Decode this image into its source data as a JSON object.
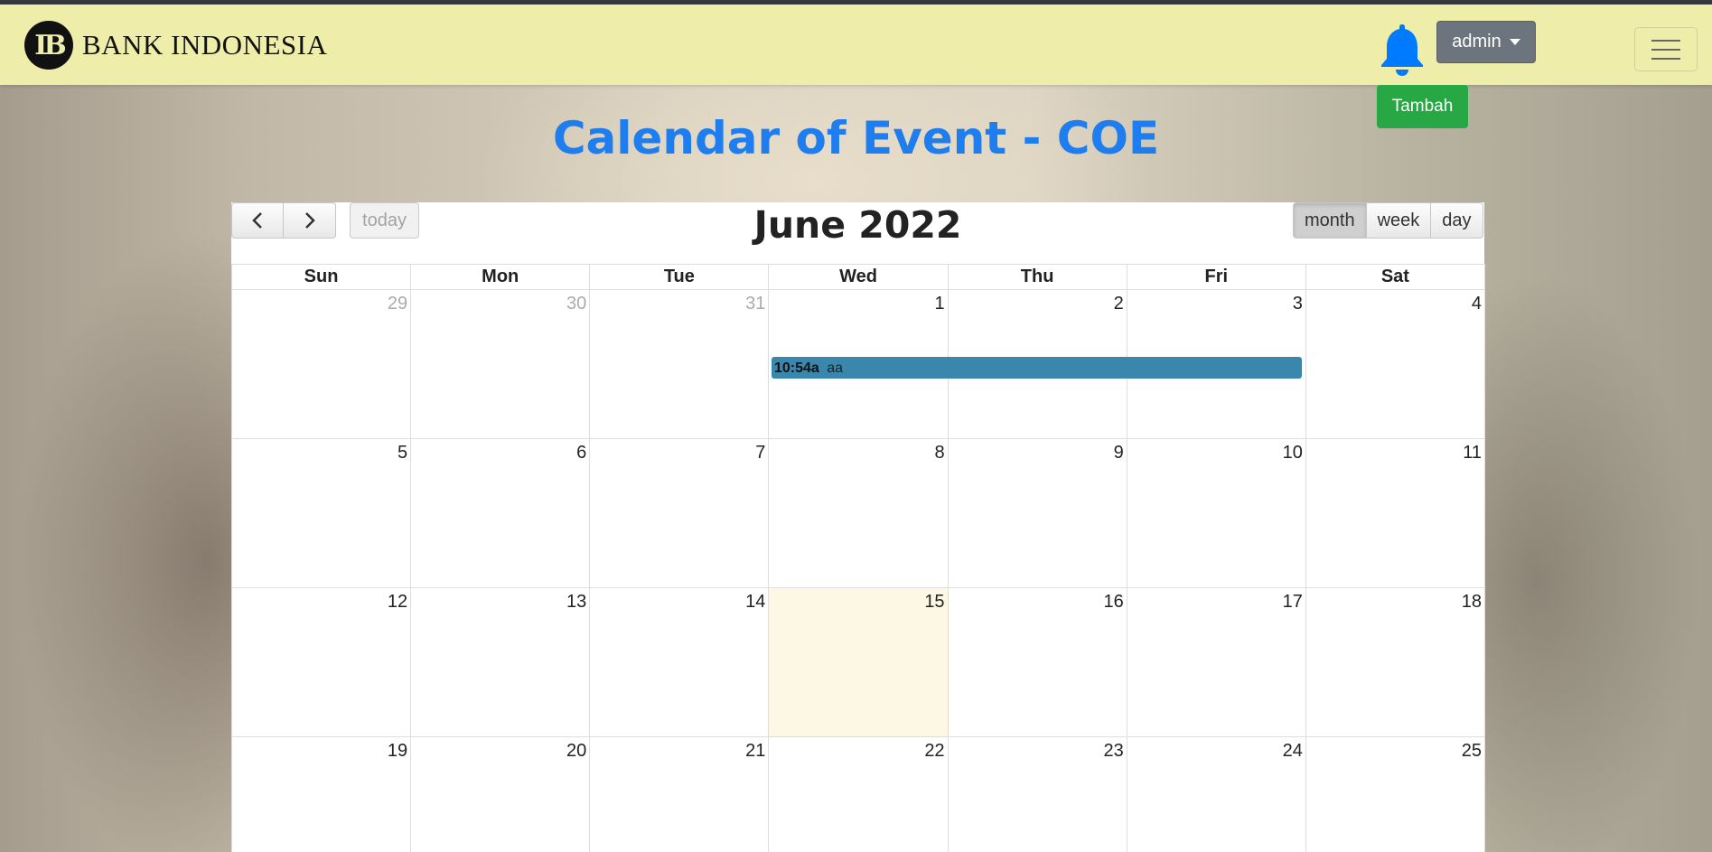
{
  "navbar": {
    "brand_text": "BANK INDONESIA",
    "logo_mark": "IB",
    "bell_icon": "bell-icon",
    "user_button": "admin",
    "menu_icon": "hamburger-menu-icon",
    "bg_color": "#eeeeaa",
    "bell_color": "#007bff"
  },
  "add_button": "Tambah",
  "page_title": "Calendar of Event - COE",
  "calendar": {
    "title": "June 2022",
    "today_button": "today",
    "prev_icon": "chevron-left-icon",
    "next_icon": "chevron-right-icon",
    "views": [
      "month",
      "week",
      "day"
    ],
    "active_view": "month",
    "weekdays": [
      "Sun",
      "Mon",
      "Tue",
      "Wed",
      "Thu",
      "Fri",
      "Sat"
    ],
    "weeks": [
      [
        "29",
        "30",
        "31",
        "1",
        "2",
        "3",
        "4"
      ],
      [
        "5",
        "6",
        "7",
        "8",
        "9",
        "10",
        "11"
      ],
      [
        "12",
        "13",
        "14",
        "15",
        "16",
        "17",
        "18"
      ],
      [
        "19",
        "20",
        "21",
        "22",
        "23",
        "24",
        "25"
      ]
    ],
    "today_date": "15",
    "event": {
      "time": "10:54a",
      "title": "aa",
      "color": "#3a87ad"
    }
  }
}
